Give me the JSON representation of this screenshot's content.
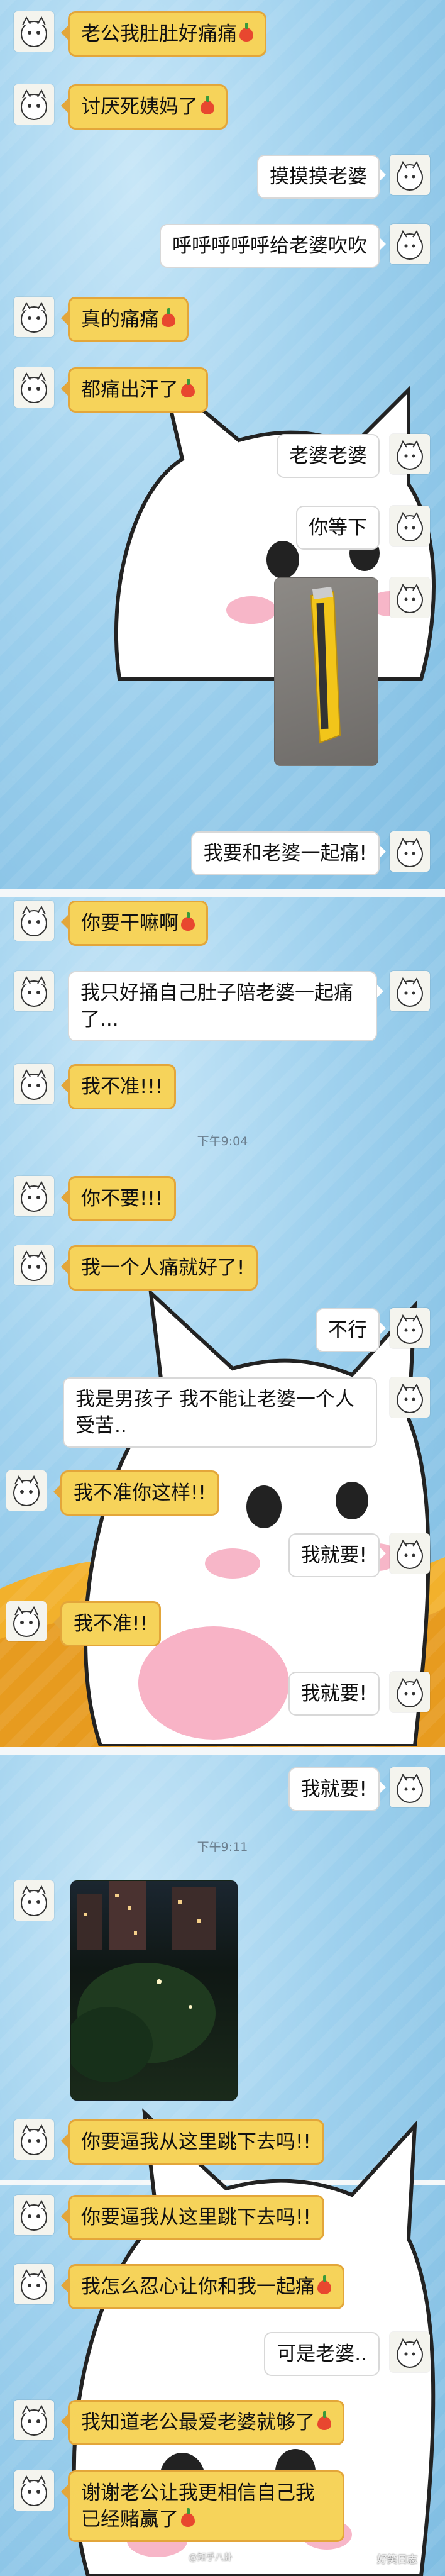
{
  "segments": {
    "s1": {
      "msgs": [
        {
          "text": "老公我肚肚好痛痛"
        },
        {
          "text": "讨厌死姨妈了"
        },
        {
          "text": "摸摸摸老婆"
        },
        {
          "text": "呼呼呼呼呼给老婆吹吹"
        },
        {
          "text": "真的痛痛"
        },
        {
          "text": "都痛出汗了"
        },
        {
          "text": "老婆老婆"
        },
        {
          "text": "你等下"
        },
        {
          "text": "我要和老婆一起痛!"
        }
      ]
    },
    "s2": {
      "time": "下午9:04",
      "msgs": [
        {
          "text": "你要干嘛啊"
        },
        {
          "text": "我只好捅自己肚子陪老婆一起痛了..."
        },
        {
          "text": "我不准!!!"
        },
        {
          "text": "你不要!!!"
        },
        {
          "text": "我一个人痛就好了!"
        },
        {
          "text": "不行"
        },
        {
          "text": "我是男孩子 我不能让老婆一个人受苦.."
        },
        {
          "text": "我不准你这样!!"
        },
        {
          "text": "我就要!"
        },
        {
          "text": "我不准!!"
        },
        {
          "text": "我就要!"
        }
      ]
    },
    "s3": {
      "time": "下午9:11",
      "msgs": [
        {
          "text": "我就要!"
        },
        {
          "text": "你要逼我从这里跳下去吗!!"
        },
        {
          "text": "你要逼我从这里跳下去吗!!"
        },
        {
          "text": "我怎么忍心让你和我一起痛"
        },
        {
          "text": "可是老婆.."
        },
        {
          "text": "我知道老公最爱老婆就够了"
        },
        {
          "text": "谢谢老公让我更相信自己我已经赌赢了"
        }
      ]
    }
  },
  "watermarks": {
    "weibo": "@知乎八卦",
    "logo": "好笑日志"
  },
  "colors": {
    "bubble_yellow": "#f6d35a",
    "bubble_border": "#e3a63a",
    "bubble_white": "#ffffff",
    "background": "#9fd1ee"
  }
}
